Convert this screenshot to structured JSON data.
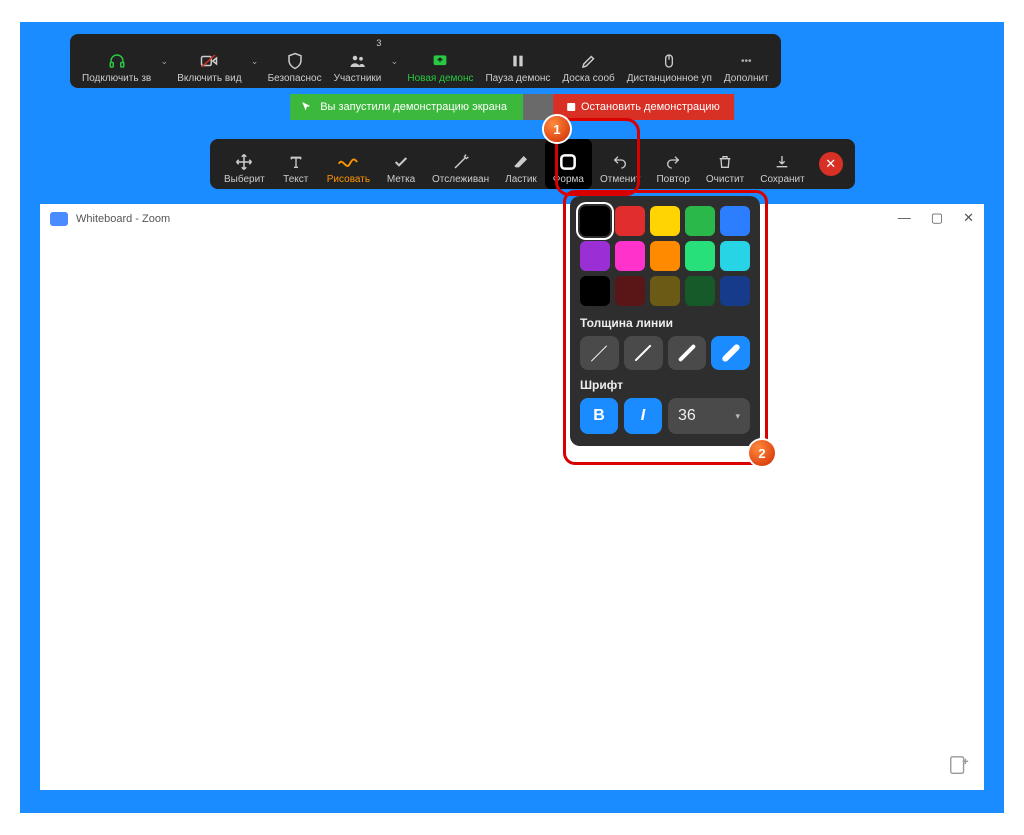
{
  "top_controls": {
    "audio": "Подключить зв",
    "video": "Включить вид",
    "security": "Безопаснос",
    "participants": "Участники",
    "participants_count": "3",
    "new_share": "Новая демонс",
    "pause_share": "Пауза демонс",
    "whiteboard": "Доска сооб",
    "remote": "Дистанционное уп",
    "more": "Дополнит"
  },
  "share_status": {
    "running": "Вы запустили демонстрацию экрана",
    "stop": "Остановить демонстрацию"
  },
  "annotate": {
    "select": "Выберит",
    "text": "Текст",
    "draw": "Рисовать",
    "stamp": "Метка",
    "spotlight": "Отслеживан",
    "eraser": "Ластик",
    "format": "Форма",
    "undo": "Отменит",
    "redo": "Повтор",
    "clear": "Очистит",
    "save": "Сохранит"
  },
  "format_panel": {
    "colors_row1": [
      "#000000",
      "#e12d2d",
      "#ffd400",
      "#2bb84a",
      "#2d7dff"
    ],
    "colors_row2": [
      "#9b2fd6",
      "#ff33cc",
      "#ff8a00",
      "#28e07a",
      "#26d4e6"
    ],
    "colors_row3": [
      "#000000",
      "#5a1616",
      "#6a5a16",
      "#165a2a",
      "#163b8a"
    ],
    "selected_color": 0,
    "thickness_label": "Толщина линии",
    "thickness": [
      1,
      2,
      4,
      6
    ],
    "thickness_selected": 3,
    "font_label": "Шрифт",
    "bold": "В",
    "italic": "I",
    "font_size": "36"
  },
  "window": {
    "title": "Whiteboard - Zoom"
  },
  "callouts": {
    "one": "1",
    "two": "2"
  }
}
